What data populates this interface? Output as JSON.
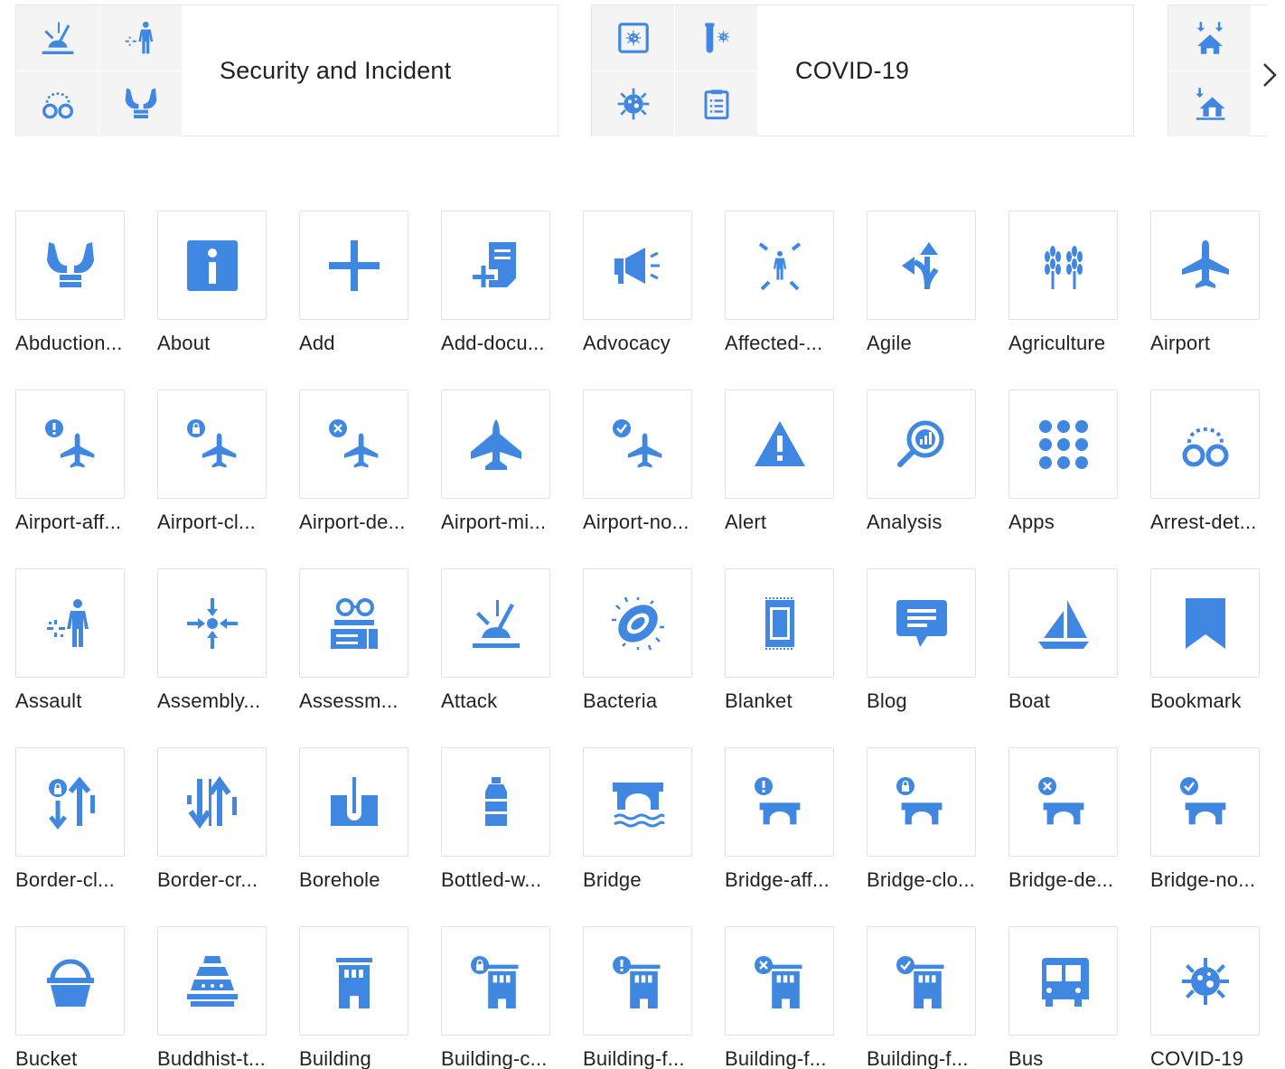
{
  "categories": [
    {
      "title": "Security and Incident",
      "icons": [
        "attack-icon",
        "assault-icon",
        "arrest-detention-icon",
        "abduction-icon"
      ]
    },
    {
      "title": "COVID-19",
      "icons": [
        "virus-screen-icon",
        "test-tube-icon",
        "virus-icon",
        "clipboard-icon"
      ]
    },
    {
      "title": "",
      "icons": [
        "house-arrivals-icon",
        "house-returnees-icon"
      ]
    }
  ],
  "navigation": {
    "next_icon": "chevron-right-icon"
  },
  "icons": [
    {
      "label": "Abduction...",
      "icon": "abduction-icon"
    },
    {
      "label": "About",
      "icon": "about-icon"
    },
    {
      "label": "Add",
      "icon": "add-icon"
    },
    {
      "label": "Add-docu...",
      "icon": "add-document-icon"
    },
    {
      "label": "Advocacy",
      "icon": "advocacy-icon"
    },
    {
      "label": "Affected-...",
      "icon": "affected-icon"
    },
    {
      "label": "Agile",
      "icon": "agile-icon"
    },
    {
      "label": "Agriculture",
      "icon": "agriculture-icon"
    },
    {
      "label": "Airport",
      "icon": "airport-icon"
    },
    {
      "label": "Airport-aff...",
      "icon": "airport-affected-icon"
    },
    {
      "label": "Airport-cl...",
      "icon": "airport-closed-icon"
    },
    {
      "label": "Airport-de...",
      "icon": "airport-destroyed-icon"
    },
    {
      "label": "Airport-mi...",
      "icon": "airport-military-icon"
    },
    {
      "label": "Airport-no...",
      "icon": "airport-not-affected-icon"
    },
    {
      "label": "Alert",
      "icon": "alert-icon"
    },
    {
      "label": "Analysis",
      "icon": "analysis-icon"
    },
    {
      "label": "Apps",
      "icon": "apps-icon"
    },
    {
      "label": "Arrest-det...",
      "icon": "arrest-detention-icon"
    },
    {
      "label": "Assault",
      "icon": "assault-icon"
    },
    {
      "label": "Assembly...",
      "icon": "assembly-point-icon"
    },
    {
      "label": "Assessm...",
      "icon": "assessment-icon"
    },
    {
      "label": "Attack",
      "icon": "attack-icon"
    },
    {
      "label": "Bacteria",
      "icon": "bacteria-icon"
    },
    {
      "label": "Blanket",
      "icon": "blanket-icon"
    },
    {
      "label": "Blog",
      "icon": "blog-icon"
    },
    {
      "label": "Boat",
      "icon": "boat-icon"
    },
    {
      "label": "Bookmark",
      "icon": "bookmark-icon"
    },
    {
      "label": "Border-cl...",
      "icon": "border-closed-icon"
    },
    {
      "label": "Border-cr...",
      "icon": "border-crossing-icon"
    },
    {
      "label": "Borehole",
      "icon": "borehole-icon"
    },
    {
      "label": "Bottled-w...",
      "icon": "bottled-water-icon"
    },
    {
      "label": "Bridge",
      "icon": "bridge-icon"
    },
    {
      "label": "Bridge-aff...",
      "icon": "bridge-affected-icon"
    },
    {
      "label": "Bridge-clo...",
      "icon": "bridge-closed-icon"
    },
    {
      "label": "Bridge-de...",
      "icon": "bridge-destroyed-icon"
    },
    {
      "label": "Bridge-no...",
      "icon": "bridge-not-affected-icon"
    },
    {
      "label": "Bucket",
      "icon": "bucket-icon"
    },
    {
      "label": "Buddhist-t...",
      "icon": "buddhist-temple-icon"
    },
    {
      "label": "Building",
      "icon": "building-icon"
    },
    {
      "label": "Building-c...",
      "icon": "building-closed-icon"
    },
    {
      "label": "Building-f...",
      "icon": "building-affected-icon"
    },
    {
      "label": "Building-f...",
      "icon": "building-destroyed-icon"
    },
    {
      "label": "Building-f...",
      "icon": "building-not-affected-icon"
    },
    {
      "label": "Bus",
      "icon": "bus-icon"
    },
    {
      "label": "COVID-19",
      "icon": "covid-19-icon"
    }
  ],
  "accent_color": "#3f87e0"
}
